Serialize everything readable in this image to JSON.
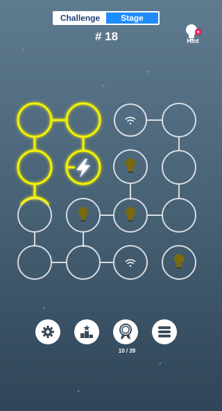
{
  "tabs": {
    "challenge": "Challenge",
    "stage": "Stage",
    "active": "challenge"
  },
  "level": "# 18",
  "hint": {
    "label": "Hint",
    "icon": "lightbulb-video-icon"
  },
  "board": {
    "grid": "4x4",
    "nodes": [
      {
        "row": 0,
        "col": 0,
        "content": "empty",
        "lit": true
      },
      {
        "row": 0,
        "col": 1,
        "content": "empty",
        "lit": true
      },
      {
        "row": 0,
        "col": 2,
        "content": "wifi-icon",
        "lit": false
      },
      {
        "row": 0,
        "col": 3,
        "content": "empty",
        "lit": false
      },
      {
        "row": 1,
        "col": 0,
        "content": "empty",
        "lit": true
      },
      {
        "row": 1,
        "col": 1,
        "content": "lightning-icon",
        "lit": true
      },
      {
        "row": 1,
        "col": 2,
        "content": "lightbulb-icon",
        "lit": false
      },
      {
        "row": 1,
        "col": 3,
        "content": "empty",
        "lit": false
      },
      {
        "row": 2,
        "col": 0,
        "content": "empty",
        "lit": false
      },
      {
        "row": 2,
        "col": 1,
        "content": "lightbulb-icon",
        "lit": false
      },
      {
        "row": 2,
        "col": 2,
        "content": "lightbulb-icon",
        "lit": false
      },
      {
        "row": 2,
        "col": 3,
        "content": "empty",
        "lit": false
      },
      {
        "row": 3,
        "col": 0,
        "content": "empty",
        "lit": false
      },
      {
        "row": 3,
        "col": 1,
        "content": "empty",
        "lit": false
      },
      {
        "row": 3,
        "col": 2,
        "content": "wifi-icon",
        "lit": false
      },
      {
        "row": 3,
        "col": 3,
        "content": "lightbulb-icon",
        "lit": false
      }
    ],
    "colors": {
      "lit": "#f5f200",
      "unlit": "#d9dde2",
      "bulb_off": "#7a6a0c"
    }
  },
  "bottom_bar": {
    "buttons": [
      "gear-icon",
      "podium-icon",
      "award-badge-icon",
      "menu-icon"
    ],
    "progress": "10 / 39"
  }
}
